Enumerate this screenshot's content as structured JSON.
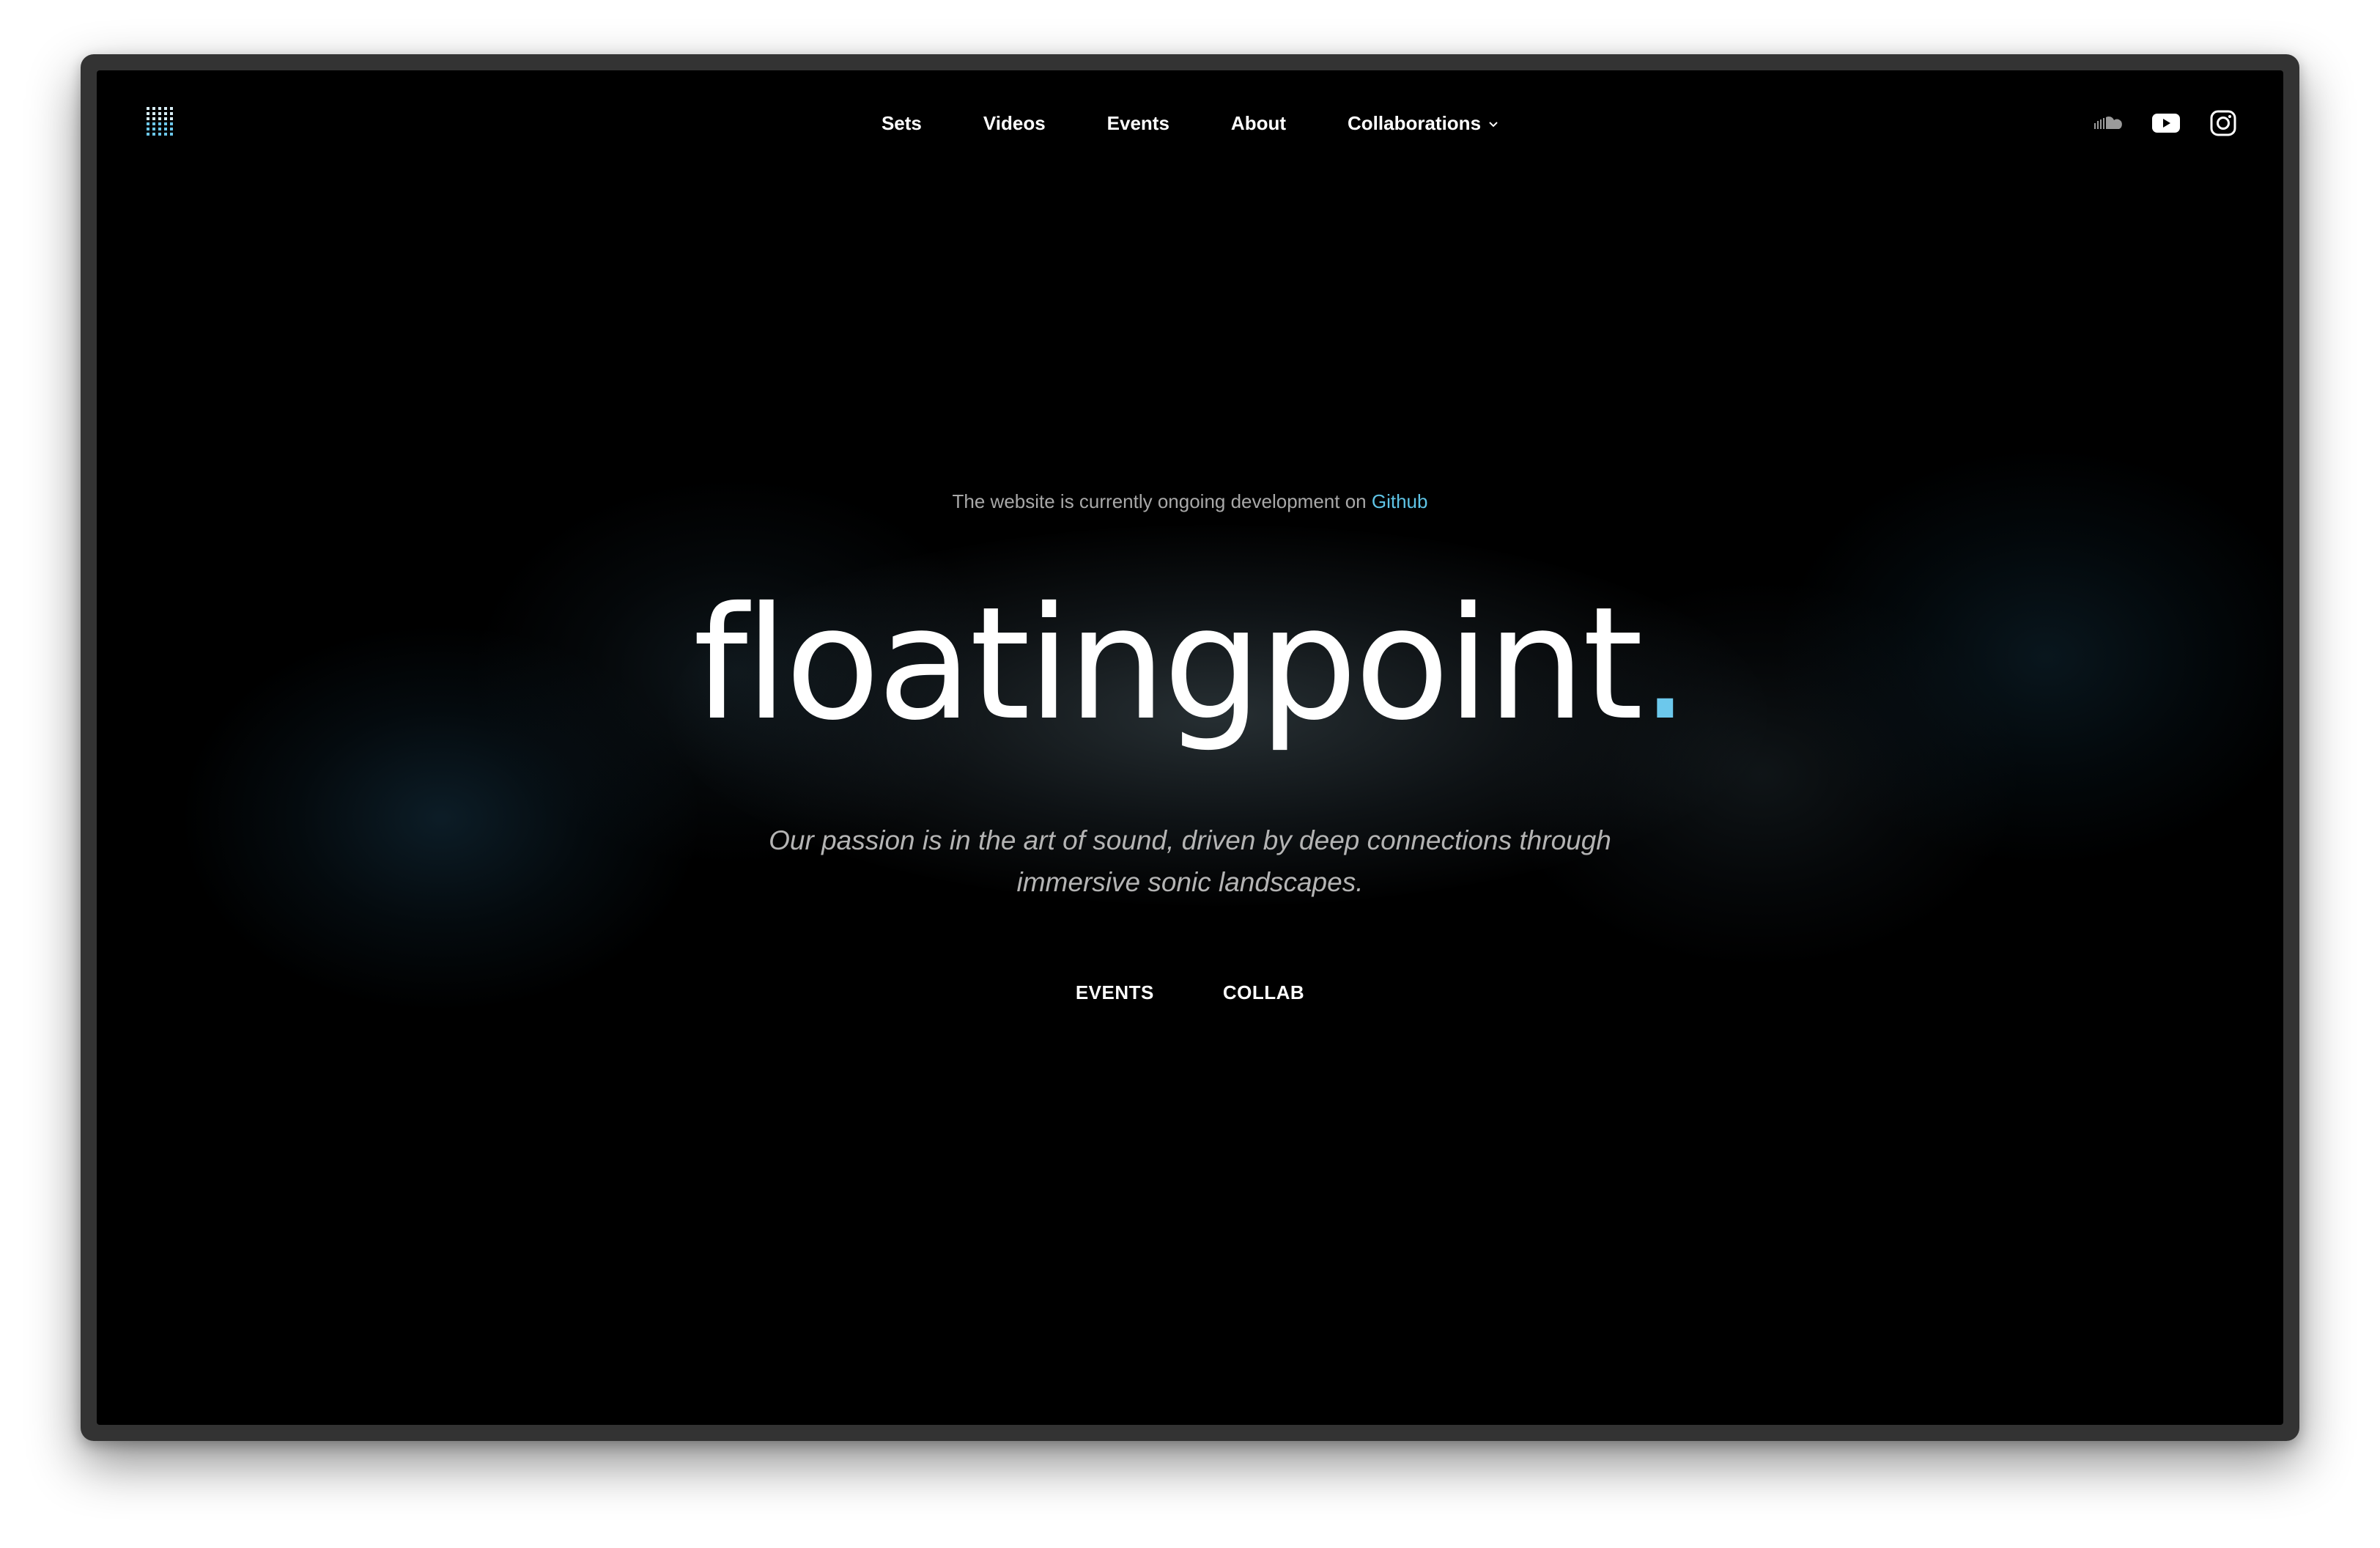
{
  "nav": {
    "items": [
      {
        "label": "Sets"
      },
      {
        "label": "Videos"
      },
      {
        "label": "Events"
      },
      {
        "label": "About"
      },
      {
        "label": "Collaborations"
      }
    ]
  },
  "social": {
    "icons": [
      "soundcloud-icon",
      "youtube-icon",
      "instagram-icon"
    ]
  },
  "hero": {
    "notice_text": "The website is currently ongoing development on",
    "notice_link": "Github",
    "brand_name": "floatingpoint",
    "brand_dot": ".",
    "tagline_line1": "Our passion is in the art of sound, driven by deep connections through",
    "tagline_line2": "immersive sonic landscapes.",
    "cta_events": "EVENTS",
    "cta_collab": "COLLAB"
  },
  "colors": {
    "background": "#000000",
    "accent": "#5fc4e6",
    "text": "#ffffff",
    "muted": "#b4b4b4"
  }
}
